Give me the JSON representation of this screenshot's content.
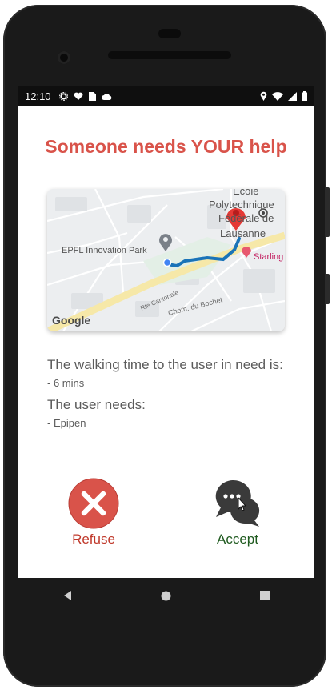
{
  "status_bar": {
    "time": "12:10",
    "left_icons": [
      "gear-icon",
      "heart-icon",
      "sim-icon",
      "cloud-icon"
    ],
    "right_icons": [
      "location-icon",
      "wifi-icon",
      "signal-icon",
      "battery-icon"
    ]
  },
  "header": {
    "title": "Someone needs YOUR help",
    "title_color": "#d9534a"
  },
  "map": {
    "labels": {
      "university_line1": "Ecole",
      "university_line2": "Polytechnique",
      "university_line3": "Fédérale de",
      "university_line4": "Lausanne",
      "park": "EPFL Innovation Park",
      "hotel": "Starling",
      "road1": "Rte Cantonale",
      "road2": "Chem. du Bochet",
      "provider": "Google"
    },
    "route_color": "#1a73b8"
  },
  "info": {
    "walking_label": "The walking time to the user in need is:",
    "walking_value": "- 6 mins",
    "needs_label": "The user needs:",
    "needs_value": "- Epipen"
  },
  "actions": {
    "refuse_label": "Refuse",
    "refuse_color": "#d9534a",
    "accept_label": "Accept",
    "accept_color": "#1f6f1f"
  },
  "nav": {
    "icons": [
      "back-icon",
      "home-icon",
      "recents-icon"
    ]
  }
}
